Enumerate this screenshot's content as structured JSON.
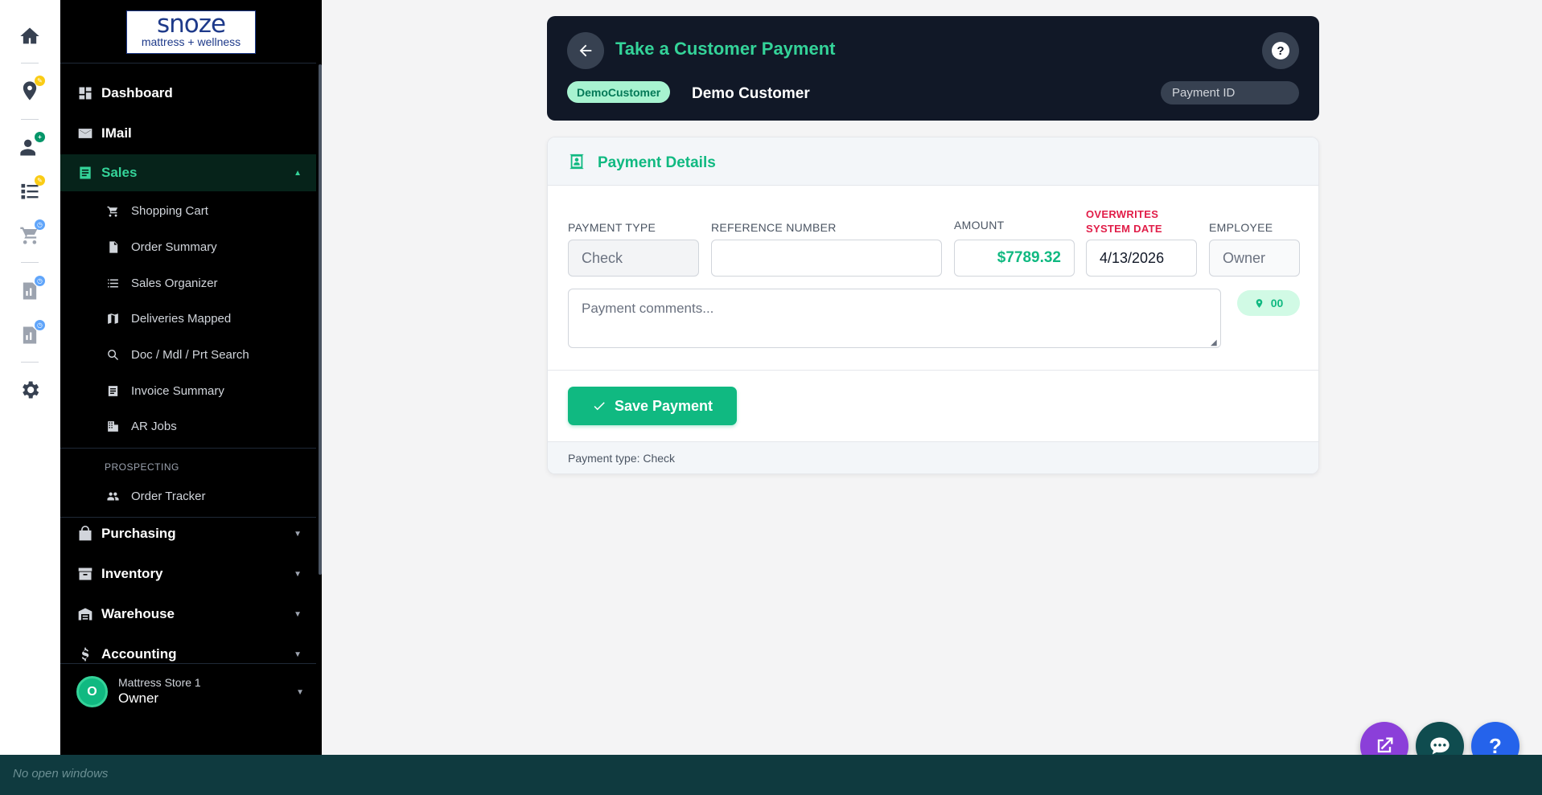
{
  "sidebar": {
    "logo": {
      "word": "snoze",
      "sub": "mattress + wellness"
    },
    "items": [
      {
        "label": "Dashboard"
      },
      {
        "label": "IMail"
      },
      {
        "label": "Sales"
      },
      {
        "label": "Purchasing"
      },
      {
        "label": "Inventory"
      },
      {
        "label": "Warehouse"
      },
      {
        "label": "Accounting"
      }
    ],
    "sales_sub": [
      {
        "label": "Shopping Cart"
      },
      {
        "label": "Order Summary"
      },
      {
        "label": "Sales Organizer"
      },
      {
        "label": "Deliveries Mapped"
      },
      {
        "label": "Doc / Mdl / Prt Search"
      },
      {
        "label": "Invoice Summary"
      },
      {
        "label": "AR Jobs"
      }
    ],
    "prospecting_label": "PROSPECTING",
    "prospecting_items": [
      {
        "label": "Order Tracker"
      }
    ],
    "store": {
      "initial": "O",
      "name": "Mattress Store 1",
      "role": "Owner"
    }
  },
  "header": {
    "title": "Take a Customer Payment",
    "customer_badge": "DemoCustomer",
    "customer_name": "Demo Customer",
    "payment_id_placeholder": "Payment ID"
  },
  "details": {
    "title": "Payment Details",
    "labels": {
      "payment_type": "PAYMENT TYPE",
      "reference_number": "REFERENCE NUMBER",
      "amount": "AMOUNT",
      "overwrites_1": "OVERWRITES",
      "overwrites_2": "SYSTEM DATE",
      "employee": "EMPLOYEE"
    },
    "values": {
      "payment_type": "Check",
      "reference_number": "",
      "amount": "$7789.32",
      "date": "4/13/2026",
      "employee": "Owner"
    },
    "comments_placeholder": "Payment comments...",
    "location_code": "00",
    "save_label": "Save Payment",
    "footer_text": "Payment type: Check"
  },
  "rail_badges": {
    "colors": {
      "yellow": "#facc15",
      "green": "#059669",
      "blue": "#60a5fa"
    }
  },
  "fab": {
    "help_label": "?"
  },
  "taskbar": {
    "text": "No open windows"
  },
  "colors": {
    "accent": "#10b981",
    "header_bg": "#111827",
    "sidebar_bg": "#000000",
    "alert": "#e11d48"
  }
}
